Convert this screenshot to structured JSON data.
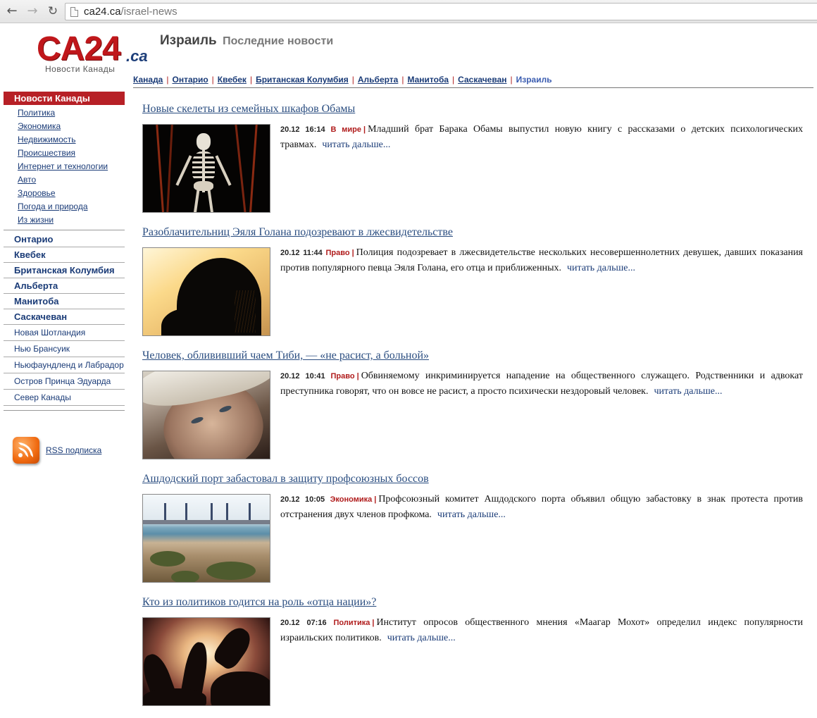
{
  "browser": {
    "url_domain": "ca24.ca",
    "url_path": "/israel-news"
  },
  "logo": {
    "main": "CA24",
    "suffix": ".ca",
    "subtitle": "Новости Канады"
  },
  "heading": {
    "main": "Израиль",
    "sub": "Последние новости"
  },
  "top_nav": {
    "links": [
      "Канада",
      "Онтарио",
      "Квебек",
      "Британская Колумбия",
      "Альберта",
      "Манитоба",
      "Саскачеван"
    ],
    "current": "Израиль",
    "separator": "|"
  },
  "sidebar": {
    "section_header": "Новости Канады",
    "sub_items": [
      "Политика",
      "Экономика",
      "Недвижимость",
      "Происшествия",
      "Интернет и технологии",
      "Авто",
      "Здоровье",
      "Погода и природа",
      "Из жизни"
    ],
    "provinces": [
      "Онтарио",
      "Квебек",
      "Британская Колумбия",
      "Альберта",
      "Манитоба",
      "Саскачеван"
    ],
    "regions": [
      "Новая Шотландия",
      "Нью Брансуик",
      "Ньюфаундленд и Лабрадор",
      "Остров Принца Эдуарда",
      "Север Канады"
    ],
    "rss_label": "RSS подписка"
  },
  "articles": [
    {
      "title": "Новые скелеты из семейных шкафов Обамы",
      "date": "20.12",
      "time": "16:14",
      "category": "В мире",
      "text": "Младший брат Барака Обамы выпустил новую книгу с рассказами о детских психологических травмах.",
      "more": "читать дальше..."
    },
    {
      "title": "Разоблачительниц Эяля Голана подозревают в лжесвидетельстве",
      "date": "20.12",
      "time": "11:44",
      "category": "Право",
      "text": "Полиция подозревает в лжесвидетельстве нескольких несовершеннолетних девушек, давших показания против популярного певца Эяля Голана, его отца и приближенных.",
      "more": "читать дальше..."
    },
    {
      "title": "Человек, облививший чаем Тиби, — «не расист, а больной»",
      "date": "20.12",
      "time": "10:41",
      "category": "Право",
      "text": "Обвиняемому инкриминируется нападение на общественного служащего. Родственники и адвокат преступника говорят, что он вовсе не расист, а просто психически нездоровый человек.",
      "more": "читать дальше..."
    },
    {
      "title": "Ашдодский порт забастовал в защиту профсоюзных боссов",
      "date": "20.12",
      "time": "10:05",
      "category": "Экономика",
      "text": "Профсоюзный комитет Ашдодского порта объявил общую забастовку в знак протеста против отстранения двух членов профкома.",
      "more": "читать дальше..."
    },
    {
      "title": "Кто из политиков годится на роль «отца нации»?",
      "date": "20.12",
      "time": "07:16",
      "category": "Политика",
      "text": "Институт опросов общественного мнения «Маагар Мохот» определил индекс популярности израильских политиков.",
      "more": "читать дальше..."
    }
  ]
}
